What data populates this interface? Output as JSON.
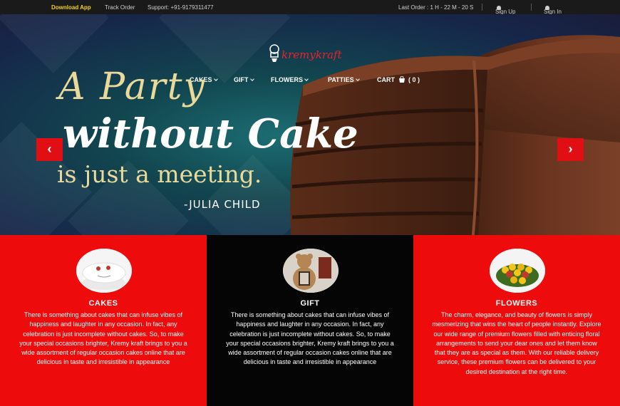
{
  "topbar": {
    "download": "Download App",
    "track": "Track Order",
    "support": "Support: +91-9179311477",
    "last_order": "Last Order : 1 H - 22 M - 20 S",
    "signup": "Sign Up",
    "signin": "Sign In"
  },
  "brand": {
    "logo_text": "kremykraft"
  },
  "nav": {
    "cakes": "CAKES",
    "gift": "GIFT",
    "flowers": "FLOWERS",
    "patties": "PATTIES",
    "cart": "CART",
    "cart_count": "( 0 )"
  },
  "hero": {
    "line1": "A Party",
    "line2": "without Cake",
    "line3": "is just a meeting.",
    "line4": "-JULIA CHILD",
    "prev": "‹",
    "next": "›"
  },
  "cards": [
    {
      "title": "CAKES",
      "body": "There is something about cakes that can infuse vibes of happiness and laughter in any occasion. In fact, any celebration is just incomplete without cakes. So, to make your special occasions brighter, Kremy kraft brings to you a wide assortment of regular occasion cakes online that are delicious in taste and irresistible in appearance"
    },
    {
      "title": "GIFT",
      "body": "There is something about cakes that can infuse vibes of happiness and laughter in any occasion. In fact, any celebration is just incomplete without cakes. So, to make your special occasions brighter, Kremy kraft brings to you a wide assortment of regular occasion cakes online that are delicious in taste and irresistible in appearance"
    },
    {
      "title": "FLOWERS",
      "body": "The charm, elegance, and beauty of flowers is simply mesmerizing that wins the heart of people instantly. Explore our wide range of premium flowers filled with enticing floral arrangements to send your dear ones and let them know that they are as special as them. With our reliable delivery service, these premium flowers can be delivered to your desired destination at the right time."
    }
  ]
}
